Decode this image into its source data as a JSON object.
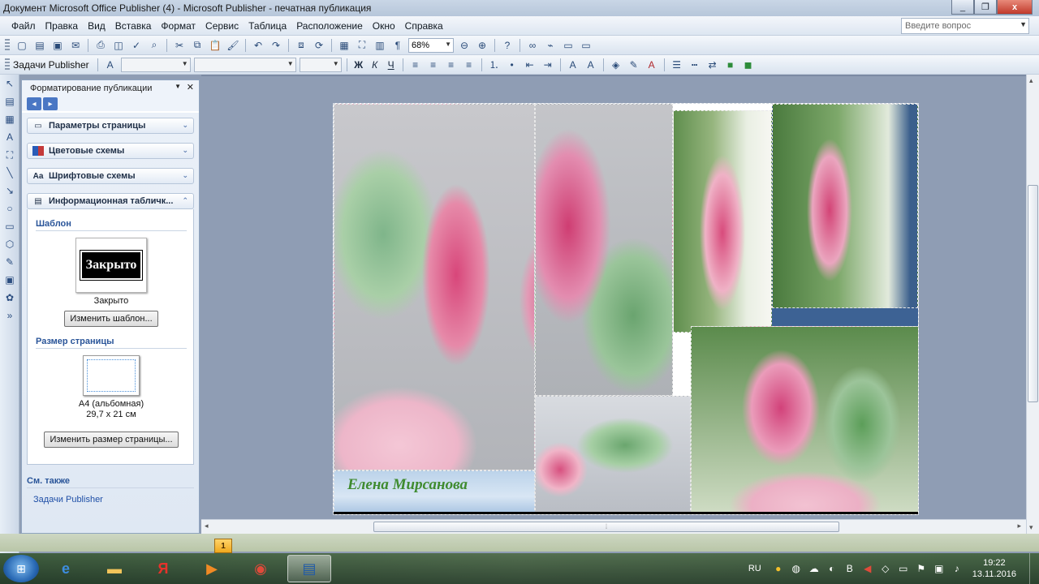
{
  "window": {
    "title": "Документ Microsoft Office Publisher (4) - Microsoft Publisher - печатная публикация",
    "controls": [
      "_",
      "❐",
      "x"
    ]
  },
  "menu": {
    "items": [
      "Файл",
      "Правка",
      "Вид",
      "Вставка",
      "Формат",
      "Сервис",
      "Таблица",
      "Расположение",
      "Окно",
      "Справка"
    ],
    "help_placeholder": "Введите вопрос"
  },
  "toolbar1": {
    "zoom": "68%"
  },
  "toolbar2": {
    "tasks_label": "Задачи Publisher",
    "format_buttons": [
      "Ж",
      "К",
      "Ч"
    ]
  },
  "taskpane": {
    "title": "Форматирование публикации",
    "sections": [
      {
        "label": "Параметры страницы",
        "icon": "page-icon"
      },
      {
        "label": "Цветовые схемы",
        "icon": "color-scheme-icon"
      },
      {
        "label": "Шрифтовые схемы",
        "icon": "font-scheme-icon"
      },
      {
        "label": "Информационная табличк...",
        "icon": "info-sign-icon"
      }
    ],
    "template_header": "Шаблон",
    "template_preview": "Закрыто",
    "template_caption": "Закрыто",
    "change_template_button": "Изменить шаблон...",
    "page_size_header": "Размер страницы",
    "page_size_name": "A4 (альбомная)",
    "page_size_dims": "29,7 x 21 см",
    "change_size_button": "Изменить размер страницы...",
    "see_also_header": "См. также",
    "see_also_link": "Задачи Publisher"
  },
  "publication": {
    "author_name": "Елена Мирсанова"
  },
  "taskbar": {
    "page_badge": "1",
    "language": "RU",
    "time": "19:22",
    "date": "13.11.2016"
  }
}
